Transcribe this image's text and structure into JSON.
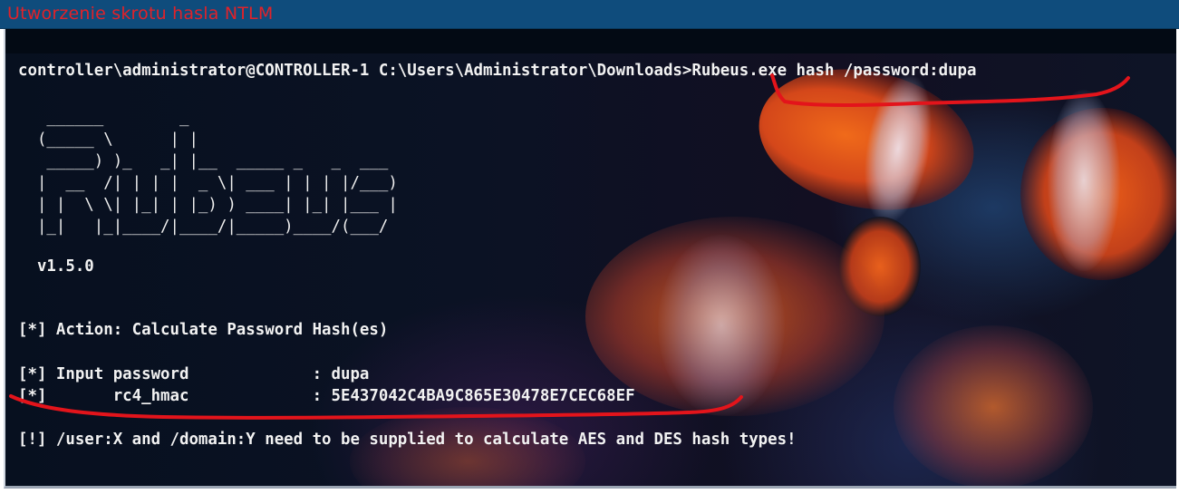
{
  "caption": {
    "title": "Utworzenie skrotu hasla NTLM"
  },
  "terminal": {
    "prompt_line": "controller\\administrator@CONTROLLER-1 C:\\Users\\Administrator\\Downloads>Rubeus.exe hash /password:dupa",
    "banner_lines": [
      "   ______        _",
      "  (_____ \\      | |",
      "   _____) )_   _| |__  _____ _   _  ___",
      "  |  __  /| | | |  _ \\| ___ | | | |/___)",
      "  | |  \\ \\| |_| | |_) ) ____| |_| |___ |",
      "  |_|   |_|____/|____/|_____)____/(___/"
    ],
    "version": "  v1.5.0",
    "action_line": "[*] Action: Calculate Password Hash(es)",
    "input_password_line": "[*] Input password             : dupa",
    "rc4_line": "[*]       rc4_hmac             : 5E437042C4BA9C865E30478E7CEC68EF",
    "warning_line": "[!] /user:X and /domain:Y need to be supplied to calculate AES and DES hash types!"
  },
  "annotation": {
    "color": "#e3141b"
  }
}
